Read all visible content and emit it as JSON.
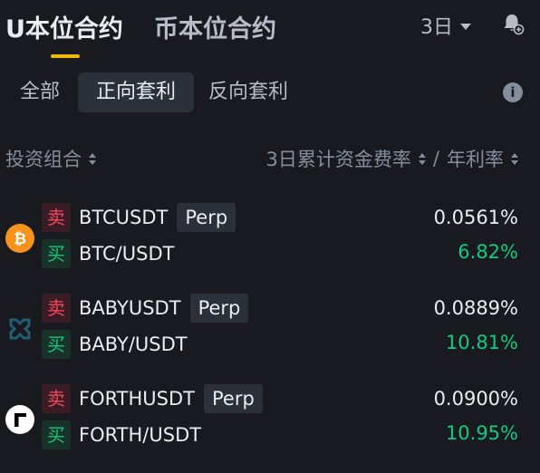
{
  "tabs": {
    "active": "U本位合约",
    "inactive": "币本位合约"
  },
  "period": {
    "label": "3日"
  },
  "filters": [
    "全部",
    "正向套利",
    "反向套利"
  ],
  "header": {
    "left": "投资组合",
    "right": "3日累计资金费率",
    "separator": "/",
    "right2": "年利率"
  },
  "colors": {
    "accent": "#f0b90b",
    "sell": "#f6465d",
    "buy": "#0ecb81",
    "background": "#181a20"
  },
  "rows": [
    {
      "coin_icon": "bitcoin-icon",
      "sell_label": "卖",
      "perp_symbol": "BTCUSDT",
      "perp_tag": "Perp",
      "buy_label": "买",
      "spot_symbol": "BTC/USDT",
      "funding_rate": "0.0561%",
      "apr": "6.82%"
    },
    {
      "coin_icon": "babylon-icon",
      "sell_label": "卖",
      "perp_symbol": "BABYUSDT",
      "perp_tag": "Perp",
      "buy_label": "买",
      "spot_symbol": "BABY/USDT",
      "funding_rate": "0.0889%",
      "apr": "10.81%"
    },
    {
      "coin_icon": "forth-icon",
      "sell_label": "卖",
      "perp_symbol": "FORTHUSDT",
      "perp_tag": "Perp",
      "buy_label": "买",
      "spot_symbol": "FORTH/USDT",
      "funding_rate": "0.0900%",
      "apr": "10.95%"
    }
  ]
}
